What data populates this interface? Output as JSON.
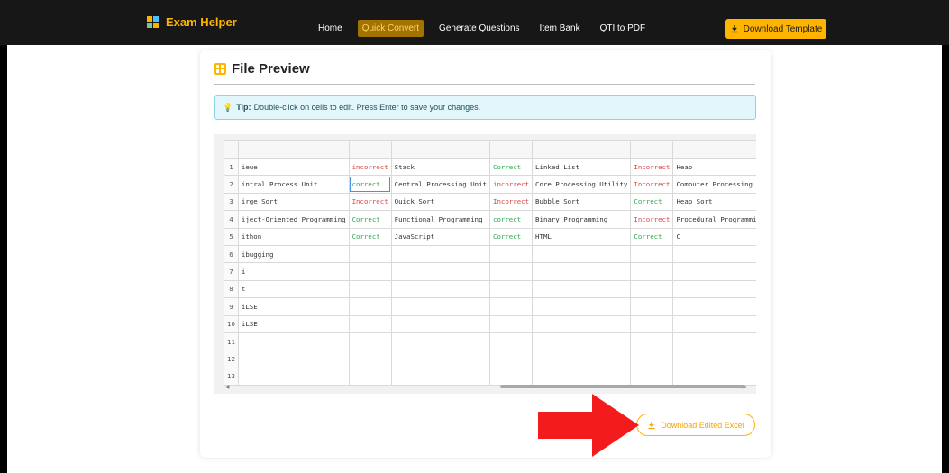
{
  "nav": {
    "brand": "Exam Helper",
    "links": [
      "Home",
      "Quick Convert",
      "Generate Questions",
      "Item Bank",
      "QTI to PDF"
    ],
    "active_link": "Quick Convert",
    "download_template": "Download Template"
  },
  "card": {
    "title": "File Preview",
    "tip_label": "Tip:",
    "tip_text": "Double-click on cells to edit. Press Enter to save your changes.",
    "download_edited": "Download Edited Excel"
  },
  "grid": {
    "rows": [
      {
        "n": "1",
        "cells": [
          "ieue",
          "incorrect",
          "Stack",
          "Correct",
          "Linked List",
          "Incorrect",
          "Heap"
        ]
      },
      {
        "n": "2",
        "cells": [
          "intral Process Unit",
          "correct",
          "Central Processing Unit",
          "incorrect",
          "Core Processing Utility",
          "Incorrect",
          "Computer Processing Unit"
        ]
      },
      {
        "n": "3",
        "cells": [
          "irge Sort",
          "Incorrect",
          "Quick Sort",
          "Incorrect",
          "Bubble Sort",
          "Correct",
          "Heap Sort"
        ]
      },
      {
        "n": "4",
        "cells": [
          "iject-Oriented Programming",
          "Correct",
          "Functional Programming",
          "correct",
          "Binary Programming",
          "Incorrect",
          "Procedural Programming"
        ]
      },
      {
        "n": "5",
        "cells": [
          "ithon",
          "Correct",
          "JavaScript",
          "Correct",
          "HTML",
          "Correct",
          "C"
        ]
      },
      {
        "n": "6",
        "cells": [
          "ibugging",
          "",
          "",
          "",
          "",
          "",
          ""
        ]
      },
      {
        "n": "7",
        "cells": [
          "i",
          "",
          "",
          "",
          "",
          "",
          ""
        ]
      },
      {
        "n": "8",
        "cells": [
          "t",
          "",
          "",
          "",
          "",
          "",
          ""
        ]
      },
      {
        "n": "9",
        "cells": [
          "iLSE",
          "",
          "",
          "",
          "",
          "",
          ""
        ]
      },
      {
        "n": "10",
        "cells": [
          "iLSE",
          "",
          "",
          "",
          "",
          "",
          ""
        ]
      },
      {
        "n": "11",
        "cells": [
          "",
          "",
          "",
          "",
          "",
          "",
          ""
        ]
      },
      {
        "n": "12",
        "cells": [
          "",
          "",
          "",
          "",
          "",
          "",
          ""
        ]
      },
      {
        "n": "13",
        "cells": [
          "",
          "",
          "",
          "",
          "",
          "",
          ""
        ]
      }
    ],
    "cell_status": {
      "good_color": "#2eaa53",
      "bad_color": "#e04343"
    }
  },
  "colors": {
    "accent": "#ffb400",
    "navbar": "#171717",
    "arrow": "#f21c1c"
  },
  "icons": {
    "brand": "grid-logo-icon",
    "download": "download-icon",
    "title": "table-icon",
    "tip": "lightbulb-icon"
  }
}
